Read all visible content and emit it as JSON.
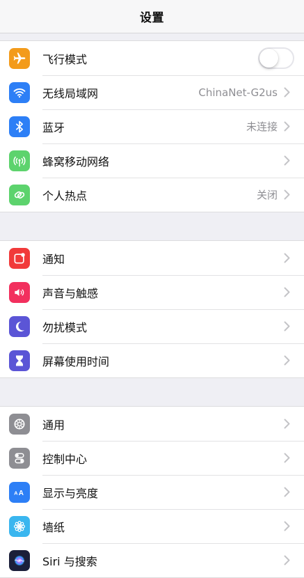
{
  "header": {
    "title": "设置"
  },
  "groups": [
    {
      "items": [
        {
          "key": "airplane",
          "label": "飞行模式",
          "icon": "airplane-icon",
          "color": "#f39b1b",
          "control": "toggle",
          "toggle_on": false
        },
        {
          "key": "wifi",
          "label": "无线局域网",
          "icon": "wifi-icon",
          "color": "#2d7ff6",
          "value": "ChinaNet-G2us"
        },
        {
          "key": "bluetooth",
          "label": "蓝牙",
          "icon": "bluetooth-icon",
          "color": "#2d7ff6",
          "value": "未连接"
        },
        {
          "key": "cellular",
          "label": "蜂窝移动网络",
          "icon": "cellular-antenna-icon",
          "color": "#5dd36d"
        },
        {
          "key": "hotspot",
          "label": "个人热点",
          "icon": "hotspot-link-icon",
          "color": "#5dd36d",
          "value": "关闭"
        }
      ]
    },
    {
      "items": [
        {
          "key": "notifications",
          "label": "通知",
          "icon": "notification-icon",
          "color": "#f13a3a"
        },
        {
          "key": "sounds",
          "label": "声音与触感",
          "icon": "speaker-icon",
          "color": "#f2305e"
        },
        {
          "key": "dnd",
          "label": "勿扰模式",
          "icon": "moon-icon",
          "color": "#5b55d6"
        },
        {
          "key": "screentime",
          "label": "屏幕使用时间",
          "icon": "hourglass-icon",
          "color": "#5b55d6"
        }
      ]
    },
    {
      "items": [
        {
          "key": "general",
          "label": "通用",
          "icon": "gear-icon",
          "color": "#8e8e93"
        },
        {
          "key": "control",
          "label": "控制中心",
          "icon": "toggles-icon",
          "color": "#8e8e93"
        },
        {
          "key": "display",
          "label": "显示与亮度",
          "icon": "text-size-icon",
          "color": "#2d7ff6"
        },
        {
          "key": "wallpaper",
          "label": "墙纸",
          "icon": "flower-icon",
          "color": "#3ab6ef"
        },
        {
          "key": "siri",
          "label": "Siri 与搜索",
          "icon": "siri-icon",
          "color": "#1b1f3a"
        }
      ]
    }
  ]
}
